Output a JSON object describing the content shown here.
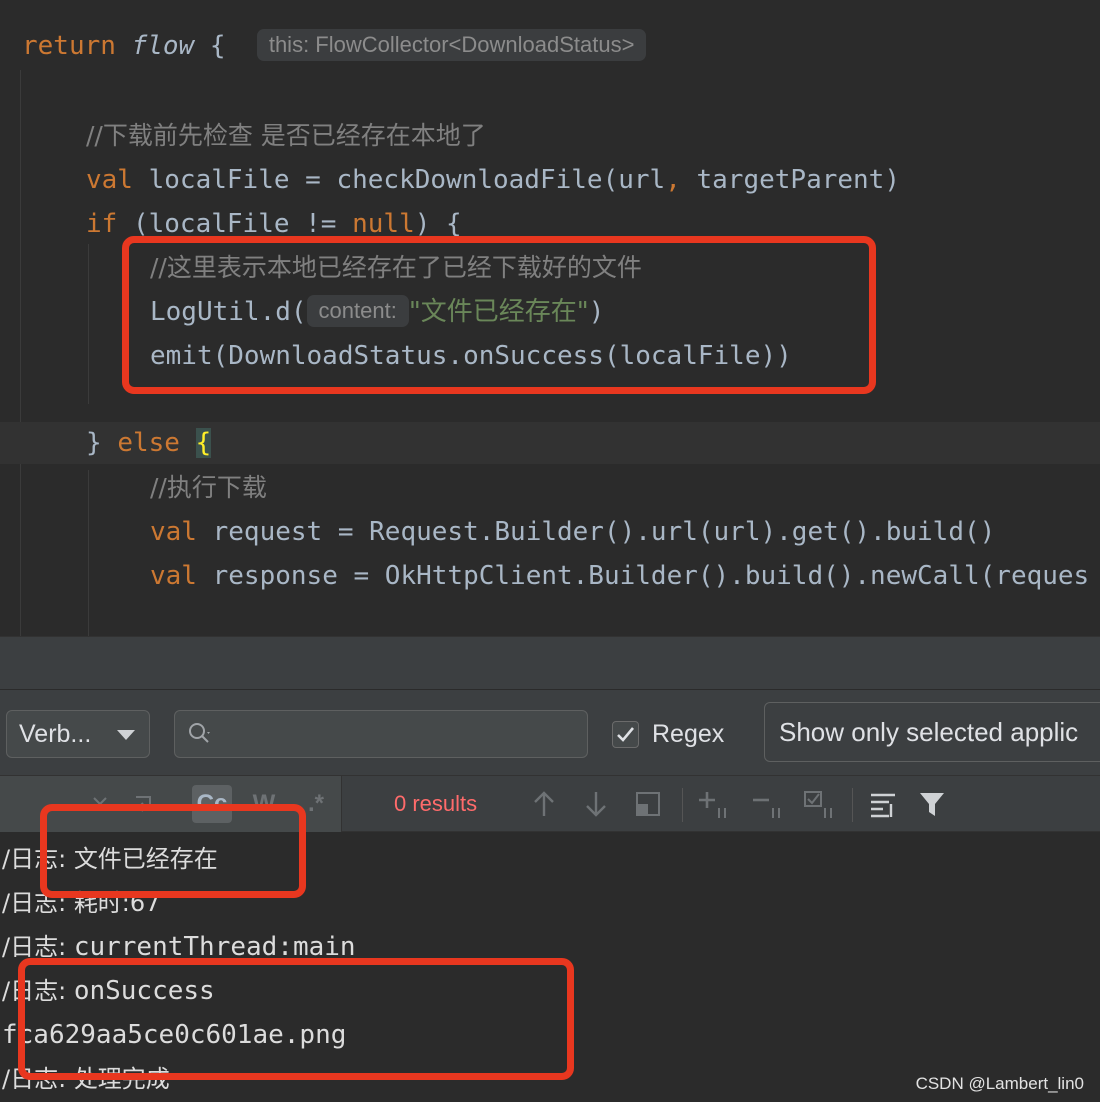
{
  "editor": {
    "line1": {
      "kw_return": "return",
      "fn_flow": "flow",
      "brace": "{",
      "hint": "this: FlowCollector<DownloadStatus>"
    },
    "line2": {
      "comment": "//下载前先检查 是否已经存在本地了"
    },
    "line3": {
      "kw": "val",
      "text": " localFile = checkDownloadFile(url",
      "comma": ",",
      "text2": " targetParent)"
    },
    "line4": {
      "kw": "if",
      "text": " (localFile != ",
      "null_kw": "null",
      "text2": ") {"
    },
    "line5": {
      "comment": "//这里表示本地已经存在了已经下载好的文件"
    },
    "line6": {
      "call": "LogUtil.d(",
      "hint": "content:",
      "string": "\"文件已经存在\"",
      "close": ")"
    },
    "line7": {
      "text": "emit(DownloadStatus.onSuccess(localFile))"
    },
    "line8": {
      "close_brace": "} ",
      "kw_else": "else",
      "open_brace": "{"
    },
    "line9": {
      "comment": "//执行下载"
    },
    "line10": {
      "kw": "val",
      "text": " request = Request.Builder().url(url).get().build()"
    },
    "line11": {
      "kw": "val",
      "text": " response = OkHttpClient.Builder().build().newCall(reques"
    }
  },
  "logcat": {
    "level_value": "Verb...",
    "search_value": "",
    "regex_label": "Regex",
    "regex_checked": true,
    "app_filter_value": "Show only selected applic",
    "find_bar": {
      "case_icon_label": "Cc",
      "word_icon_label": "W",
      "regex_icon_label": ".*",
      "results_text": "0 results"
    },
    "log_lines": [
      {
        "prefix": "/日志: ",
        "message": "文件已经存在"
      },
      {
        "prefix": "/日志: ",
        "message": "耗时:67"
      },
      {
        "prefix": "/日志: ",
        "message": "currentThread:main"
      },
      {
        "prefix": "/日志: ",
        "message": "onSuccess"
      },
      {
        "prefix": "f",
        "message": "ca629aa5ce0c601ae.png"
      },
      {
        "prefix": "/日志: ",
        "message": "处理完成"
      }
    ]
  },
  "watermark": "CSDN @Lambert_lin0",
  "colors": {
    "editor_bg": "#2b2b2b",
    "keyword": "#cc7832",
    "string": "#6a8759",
    "comment": "#808080",
    "annotation_red": "#e8371f",
    "results_red": "#ff6b6b"
  }
}
